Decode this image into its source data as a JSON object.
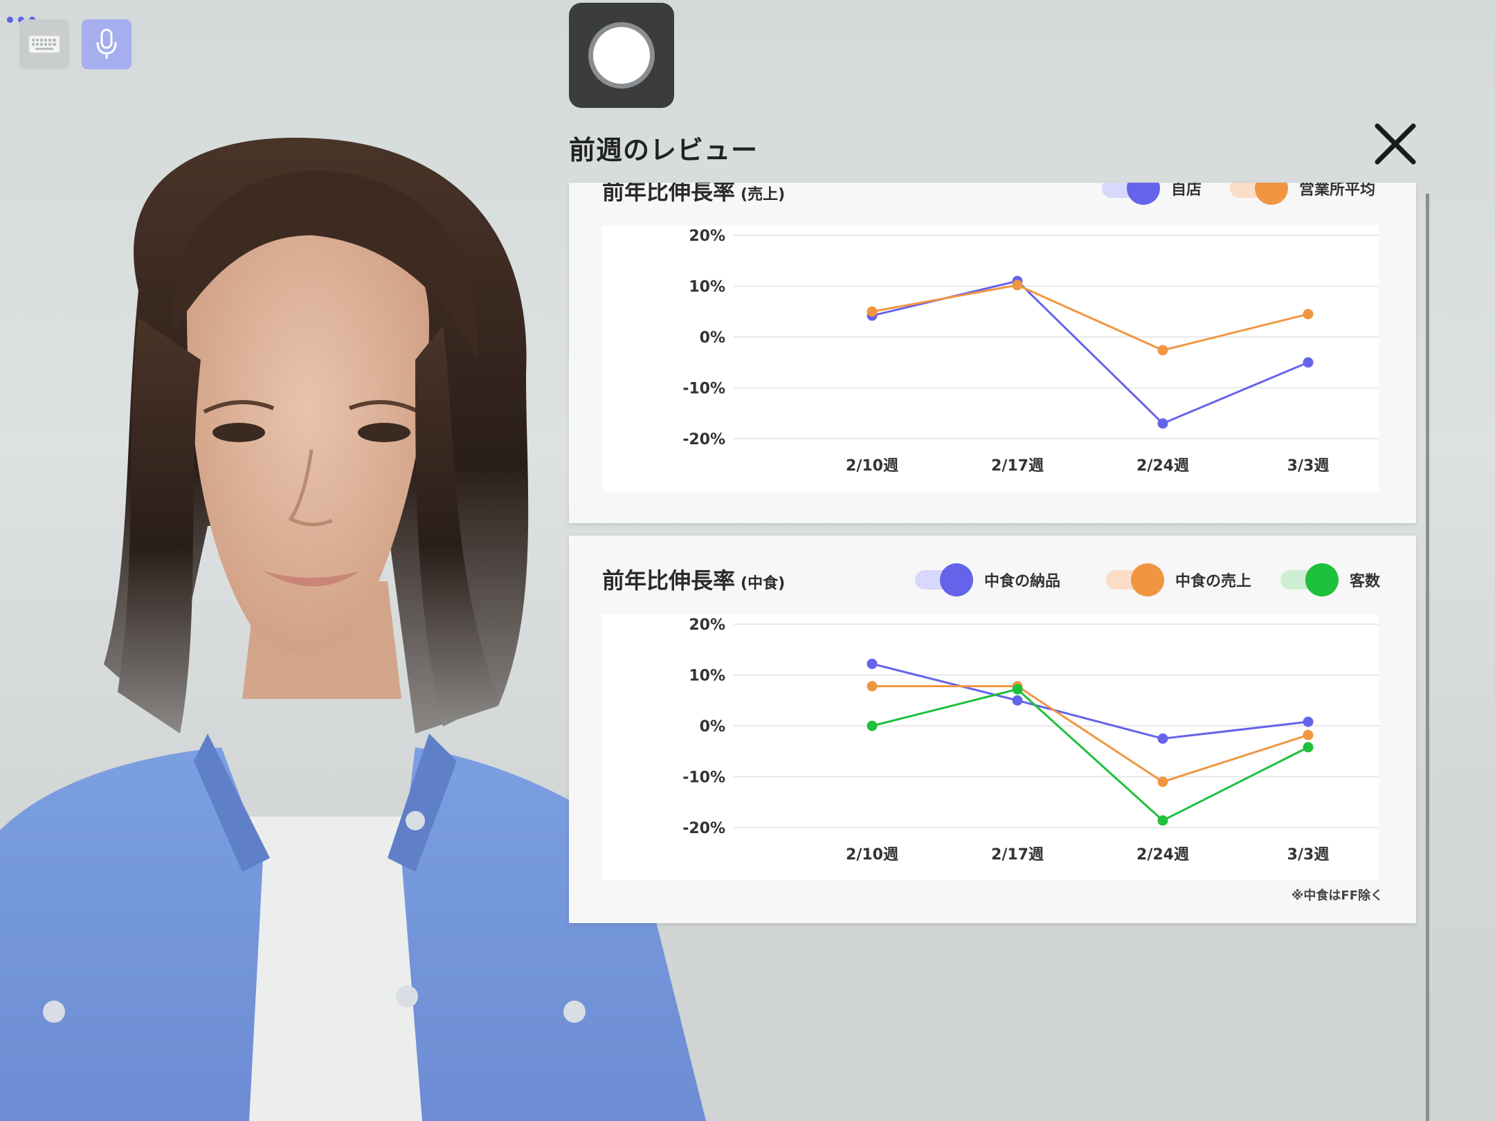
{
  "controls": {
    "keyboard_icon": "keyboard-icon",
    "mic_icon": "microphone-icon",
    "more_icon": "more-dots-icon",
    "record_icon": "record-icon"
  },
  "panel": {
    "title": "前週のレビュー",
    "close_icon": "close-icon",
    "accent_color": "#5660e6"
  },
  "chart_data": [
    {
      "type": "line",
      "title": "前年比伸長率",
      "subtitle": "(売上)",
      "categories": [
        "2/10週",
        "2/17週",
        "2/24週",
        "3/3週"
      ],
      "yticks": [
        "20%",
        "10%",
        "0%",
        "-10%",
        "-20%"
      ],
      "ylim": [
        -20,
        20
      ],
      "grid": true,
      "legend": "top-right",
      "series": [
        {
          "name": "自店",
          "color": "#6563ea",
          "values": [
            4.2,
            11,
            -17,
            -5
          ]
        },
        {
          "name": "営業所平均",
          "color": "#f09642",
          "values": [
            5,
            10.2,
            -2.6,
            4.5
          ]
        }
      ]
    },
    {
      "type": "line",
      "title": "前年比伸長率",
      "subtitle": "(中食)",
      "categories": [
        "2/10週",
        "2/17週",
        "2/24週",
        "3/3週"
      ],
      "yticks": [
        "20%",
        "10%",
        "0%",
        "-10%",
        "-20%"
      ],
      "ylim": [
        -20,
        20
      ],
      "grid": true,
      "legend": "top-right",
      "footnote": "※中食はFF除く",
      "series": [
        {
          "name": "中食の納品",
          "color": "#6563ea",
          "values": [
            12.2,
            5,
            -2.5,
            0.8
          ]
        },
        {
          "name": "中食の売上",
          "color": "#f09642",
          "values": [
            7.8,
            7.8,
            -11,
            -1.8
          ]
        },
        {
          "name": "客数",
          "color": "#1ec03c",
          "values": [
            0,
            7.2,
            -18.6,
            -4.2
          ]
        }
      ]
    }
  ]
}
